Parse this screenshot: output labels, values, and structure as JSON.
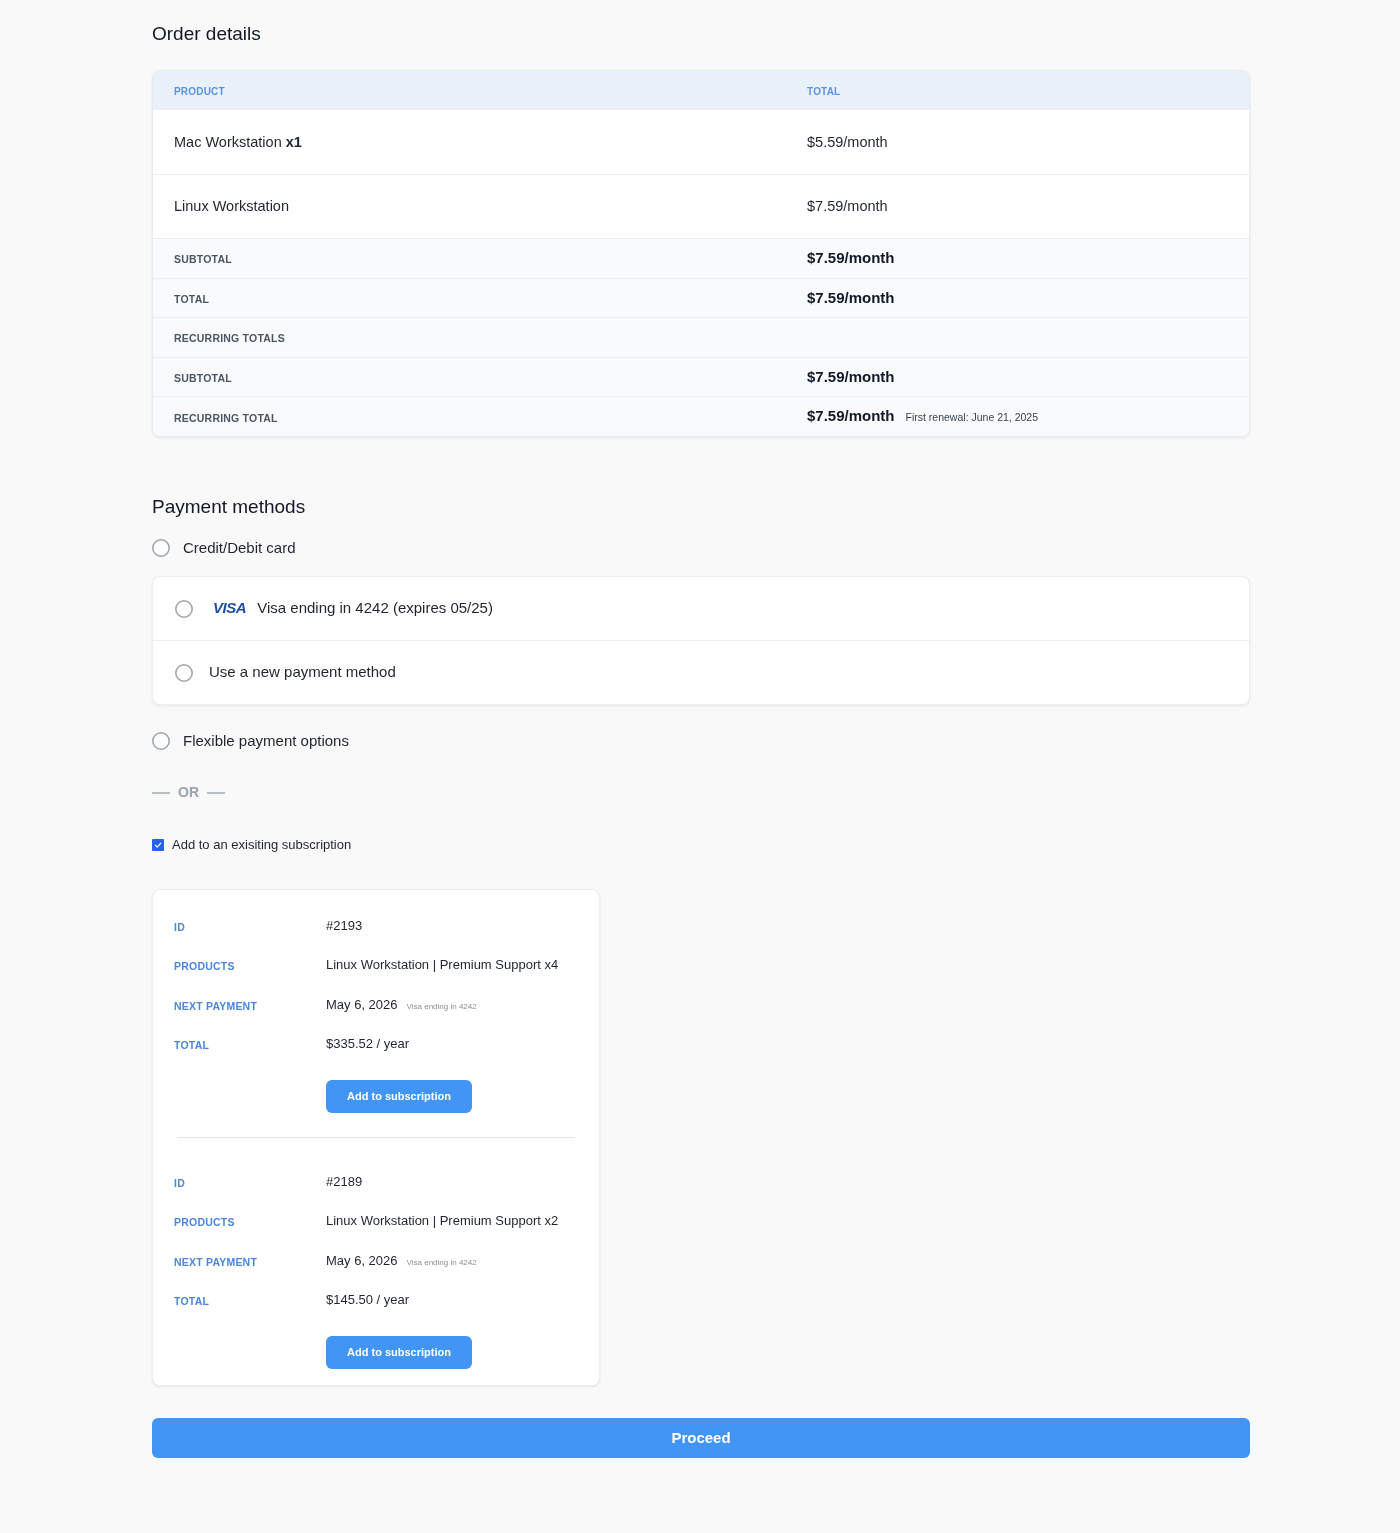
{
  "order_details": {
    "title": "Order details",
    "columns": [
      "PRODUCT",
      "TOTAL"
    ],
    "items": [
      {
        "product": "Mac Workstation **x1**",
        "total": "$5.59/month"
      },
      {
        "product": "Linux Workstation",
        "total": "$7.59/month"
      }
    ],
    "summary": [
      {
        "label": "SUBTOTAL",
        "value": "$7.59/month"
      },
      {
        "label": "TOTAL",
        "value": "$7.59/month"
      },
      {
        "label": "RECURRING TOTALS"
      },
      {
        "label": "SUBTOTAL",
        "value": "$7.59/month"
      },
      {
        "label": "RECURRING TOTAL",
        "value": "$7.59/month",
        "note": "First renewal: June 21, 2025"
      }
    ]
  },
  "payment_methods": {
    "title": "Payment methods",
    "options": [
      {
        "label": "Credit/Debit card",
        "selected": false,
        "methods": [
          {
            "kind": "card",
            "brand": "VISA",
            "label": "Visa ending in 4242 (expires 05/25)",
            "selected": false
          },
          {
            "kind": "new",
            "label": "Use a new payment method",
            "selected": false
          }
        ]
      },
      {
        "label": "Flexible payment options",
        "selected": false
      }
    ]
  },
  "separator": "OR",
  "existing_subscription": {
    "label": "Add to an exisiting subscription",
    "checked": true,
    "subscriptions": [
      {
        "fields": [
          {
            "label": "ID",
            "value": "#2193"
          },
          {
            "label": "PRODUCTS",
            "value": "Linux Workstation | Premium Support x4"
          },
          {
            "label": "NEXT PAYMENT",
            "value": "May 6, 2026",
            "note": "Visa ending in 4242"
          },
          {
            "label": "TOTAL",
            "value": "$335.52 / year"
          }
        ],
        "button": "Add to subscription"
      },
      {
        "fields": [
          {
            "label": "ID",
            "value": "#2189"
          },
          {
            "label": "PRODUCTS",
            "value": "Linux Workstation | Premium Support x2"
          },
          {
            "label": "NEXT PAYMENT",
            "value": "May 6, 2026",
            "note": "Visa ending in 4242"
          },
          {
            "label": "TOTAL",
            "value": "$145.50 / year"
          }
        ],
        "button": "Add to subscription"
      }
    ]
  },
  "proceed_button": "Proceed"
}
